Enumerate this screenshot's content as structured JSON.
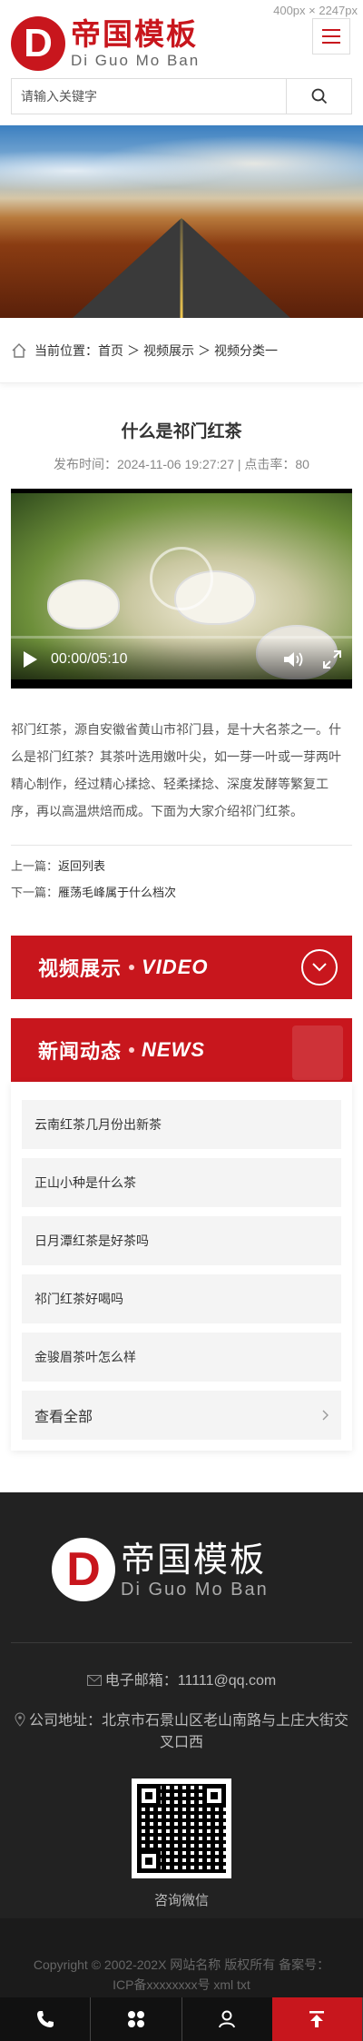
{
  "page_size_label": "400px × 2247px",
  "header": {
    "logo_letter": "D",
    "logo_cn": "帝国模板",
    "logo_en": "Di Guo Mo Ban"
  },
  "search": {
    "placeholder": "请输入关键字"
  },
  "breadcrumb": {
    "prefix": "当前位置：",
    "items": [
      "首页",
      "视频展示",
      "视频分类一"
    ],
    "sep": "＞"
  },
  "article": {
    "title": "什么是祁门红茶",
    "meta": "发布时间：2024-11-06 19:27:27 | 点击率：80",
    "video_time": "00:00/05:10",
    "body": "祁门红茶，源自安徽省黄山市祁门县，是十大名茶之一。什么是祁门红茶？其茶叶选用嫩叶尖，如一芽一叶或一芽两叶精心制作，经过精心揉捻、轻柔揉捻、深度发酵等繁复工序，再以高温烘焙而成。下面为大家介绍祁门红茶。",
    "prev_label": "上一篇：",
    "prev_link": "返回列表",
    "next_label": "下一篇：",
    "next_link": "雁荡毛峰属于什么档次"
  },
  "video_section": {
    "cn": "视频展示",
    "en": "VIDEO"
  },
  "news_section": {
    "cn": "新闻动态",
    "en": "NEWS",
    "items": [
      "云南红茶几月份出新茶",
      "正山小种是什么茶",
      "日月潭红茶是好茶吗",
      "祁门红茶好喝吗",
      "金骏眉茶叶怎么样"
    ],
    "view_all": "查看全部"
  },
  "footer": {
    "logo_letter": "D",
    "logo_cn": "帝国模板",
    "logo_en": "Di Guo Mo Ban",
    "email": "电子邮箱：11111@qq.com",
    "address": "公司地址：北京市石景山区老山南路与上庄大街交叉口西",
    "qr_caption": "咨询微信",
    "copyright_1": "Copyright © 2002-202X 网站名称 版权所有 备案号：",
    "copyright_2": "ICP备xxxxxxxx号 xml txt"
  }
}
